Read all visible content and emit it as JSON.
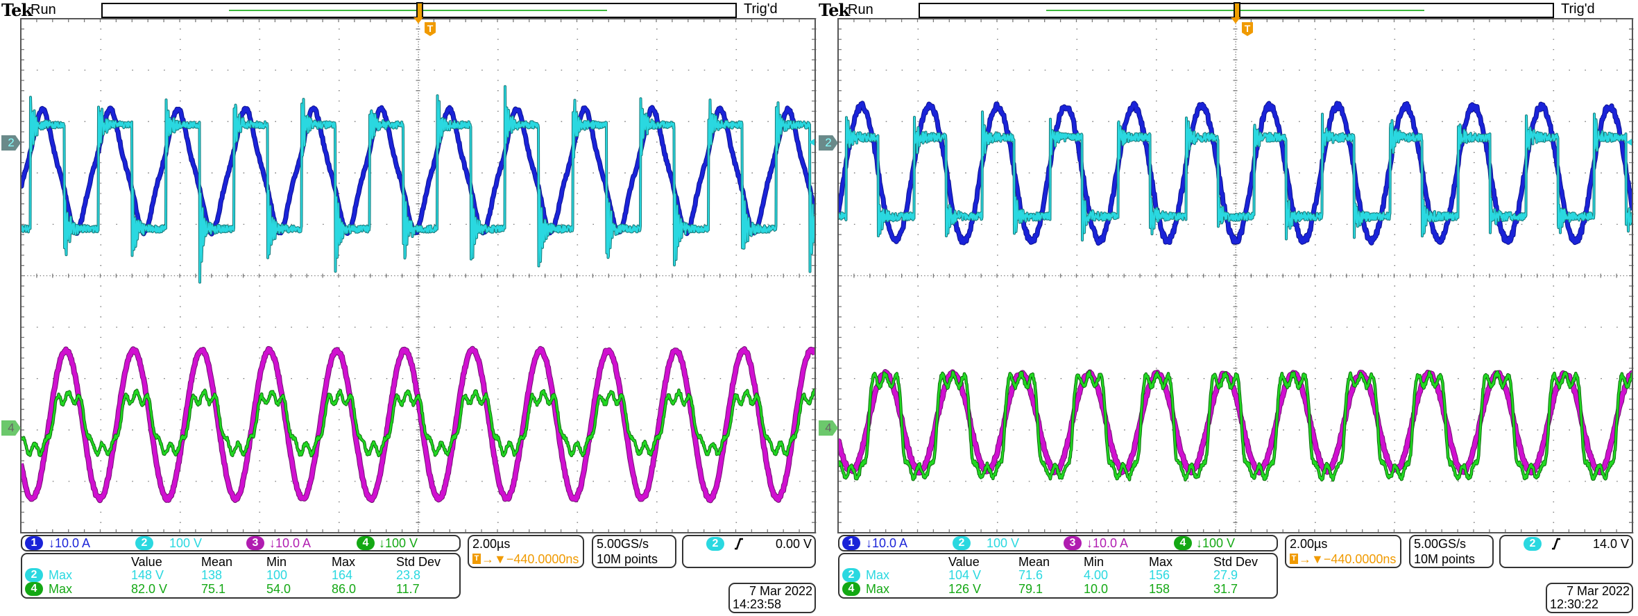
{
  "colors": {
    "ch1": "#1a23d8",
    "ch2": "#2ad8e0",
    "ch3": "#b01cb0",
    "ch4": "#14a814",
    "orange": "#f09a00"
  },
  "scopes": [
    {
      "brand": "Tek",
      "state": "Run",
      "trigger_status": "Trig'd",
      "trigger_badge": "T",
      "markers": {
        "ch2": "2",
        "ch4": "4"
      },
      "channels": [
        {
          "num": "1",
          "label": "↓10.0 A"
        },
        {
          "num": "2",
          "label": "100 V"
        },
        {
          "num": "3",
          "label": "↓10.0 A"
        },
        {
          "num": "4",
          "label": "↓100 V"
        }
      ],
      "measurements": {
        "headers": [
          "Value",
          "Mean",
          "Min",
          "Max",
          "Std Dev"
        ],
        "rows": [
          {
            "ch": "2",
            "type": "Max",
            "values": [
              "148 V",
              "138",
              "100",
              "164",
              "23.8"
            ]
          },
          {
            "ch": "4",
            "type": "Max",
            "values": [
              "82.0 V",
              "75.1",
              "54.0",
              "86.0",
              "11.7"
            ]
          }
        ]
      },
      "timebase": {
        "scale": "2.00µs",
        "delay_badge": "T",
        "delay": "→▼−440.0000ns"
      },
      "acquisition": {
        "rate": "5.00GS/s",
        "record": "10M points"
      },
      "trigger": {
        "source": "2",
        "slope": "rising-edge",
        "level": "0.00 V"
      },
      "date": "7 Mar 2022",
      "time": "14:23:58"
    },
    {
      "brand": "Tek",
      "state": "Run",
      "trigger_status": "Trig'd",
      "trigger_badge": "T",
      "markers": {
        "ch2": "2",
        "ch4": "4"
      },
      "channels": [
        {
          "num": "1",
          "label": "↓10.0 A"
        },
        {
          "num": "2",
          "label": "100 V"
        },
        {
          "num": "3",
          "label": "↓10.0 A"
        },
        {
          "num": "4",
          "label": "↓100 V"
        }
      ],
      "measurements": {
        "headers": [
          "Value",
          "Mean",
          "Min",
          "Max",
          "Std Dev"
        ],
        "rows": [
          {
            "ch": "2",
            "type": "Max",
            "values": [
              "104 V",
              "71.6",
              "4.00",
              "156",
              "27.9"
            ]
          },
          {
            "ch": "4",
            "type": "Max",
            "values": [
              "126 V",
              "79.1",
              "10.0",
              "158",
              "31.7"
            ]
          }
        ]
      },
      "timebase": {
        "scale": "2.00µs",
        "delay_badge": "T",
        "delay": "→▼−440.0000ns"
      },
      "acquisition": {
        "rate": "5.00GS/s",
        "record": "10M points"
      },
      "trigger": {
        "source": "2",
        "slope": "rising-edge",
        "level": "14.0 V"
      },
      "date": "7 Mar 2022",
      "time": "12:30:22"
    }
  ]
}
